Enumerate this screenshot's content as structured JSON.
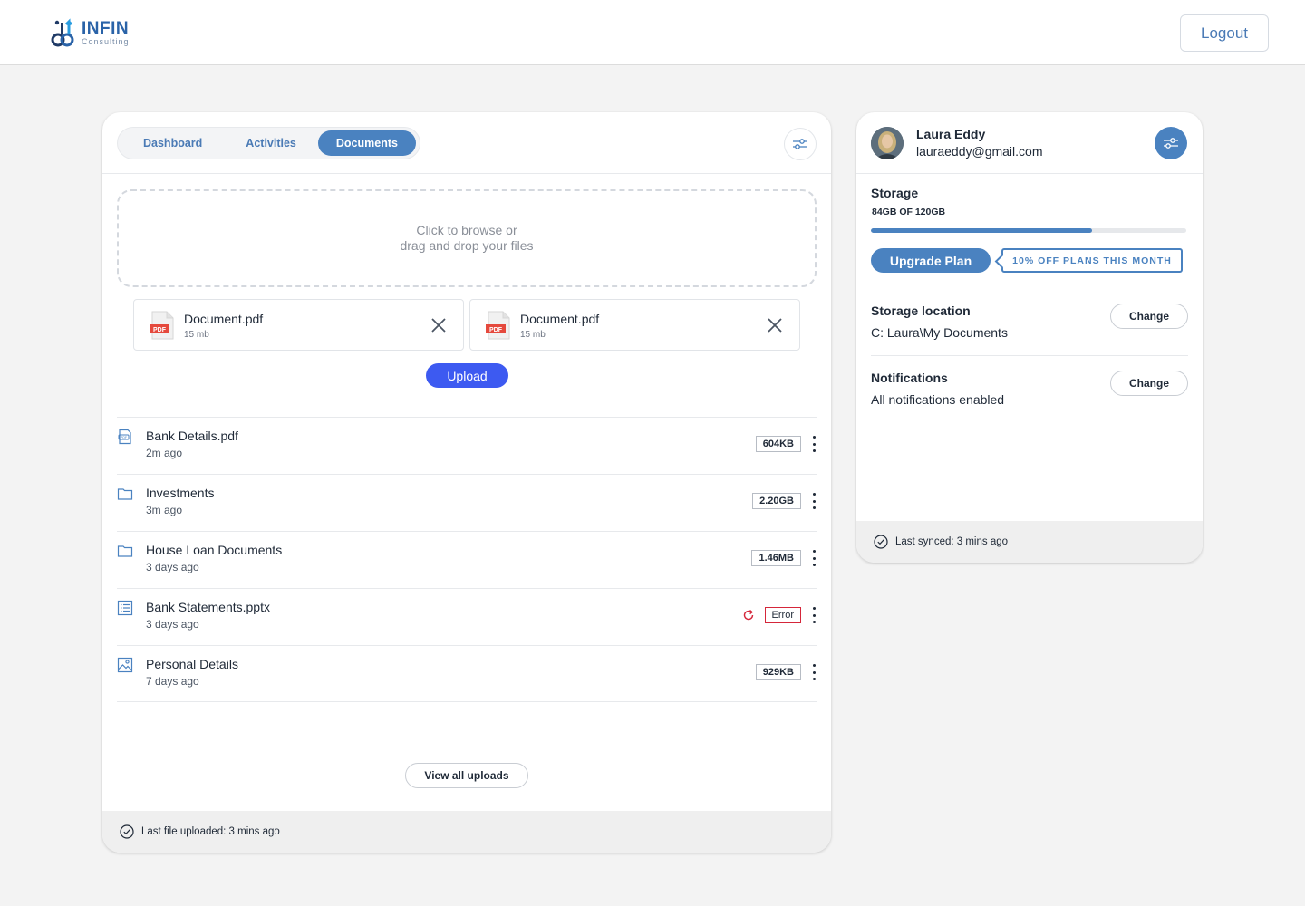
{
  "brand": {
    "name": "INFIN",
    "tagline": "Consulting"
  },
  "header": {
    "logout_label": "Logout"
  },
  "tabs": [
    {
      "label": "Dashboard",
      "active": false
    },
    {
      "label": "Activities",
      "active": false
    },
    {
      "label": "Documents",
      "active": true
    }
  ],
  "dropzone": {
    "line1": "Click to browse or",
    "line2": "drag and drop your files"
  },
  "pending_files": [
    {
      "name": "Document.pdf",
      "size": "15 mb",
      "type_badge": "PDF"
    },
    {
      "name": "Document.pdf",
      "size": "15 mb",
      "type_badge": "PDF"
    }
  ],
  "upload_label": "Upload",
  "files": [
    {
      "name": "Bank Details.pdf",
      "time": "2m ago",
      "size": "604KB",
      "icon": "pdf-file-icon",
      "status": "ok"
    },
    {
      "name": "Investments",
      "time": "3m ago",
      "size": "2.20GB",
      "icon": "folder-icon",
      "status": "ok"
    },
    {
      "name": "House Loan Documents",
      "time": "3 days ago",
      "size": "1.46MB",
      "icon": "folder-icon",
      "status": "ok"
    },
    {
      "name": "Bank Statements.pptx",
      "time": "3 days ago",
      "size": "Error",
      "icon": "list-file-icon",
      "status": "error"
    },
    {
      "name": "Personal Details",
      "time": "7 days ago",
      "size": "929KB",
      "icon": "image-file-icon",
      "status": "ok"
    }
  ],
  "view_all_label": "View all uploads",
  "main_footer": "Last file uploaded: 3 mins ago",
  "user": {
    "name": "Laura Eddy",
    "email": "lauraeddy@gmail.com"
  },
  "storage": {
    "title": "Storage",
    "amount_label": "84GB OF 120GB",
    "used_fraction": 0.7,
    "upgrade_label": "Upgrade Plan",
    "promo_label": "10% OFF PLANS THIS MONTH"
  },
  "settings": [
    {
      "title": "Storage location",
      "value": "C: Laura\\My Documents",
      "button": "Change"
    },
    {
      "title": "Notifications",
      "value": "All notifications enabled",
      "button": "Change"
    }
  ],
  "side_footer": "Last synced: 3 mins ago",
  "colors": {
    "accent": "#4a82c0",
    "primary_button": "#3d5af1",
    "error": "#d5263a",
    "pdf_red": "#e5493d"
  }
}
